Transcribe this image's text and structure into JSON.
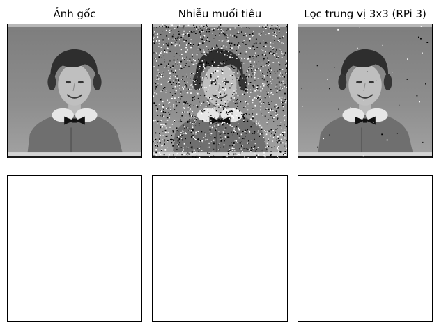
{
  "figure": {
    "titles": [
      "Ảnh gốc",
      "Nhiễu muối tiêu",
      "Lọc trung vị 3x3 (RPi 3)"
    ],
    "row1": [
      {
        "content": "portrait-original",
        "noise": "none"
      },
      {
        "content": "portrait-salt-pepper",
        "noise": "heavy"
      },
      {
        "content": "portrait-median-filtered",
        "noise": "residual"
      }
    ],
    "row2": [
      {
        "content": "empty"
      },
      {
        "content": "empty"
      },
      {
        "content": "empty"
      }
    ],
    "colors": {
      "background": "#8a8a8a",
      "frame": "#000000"
    }
  }
}
